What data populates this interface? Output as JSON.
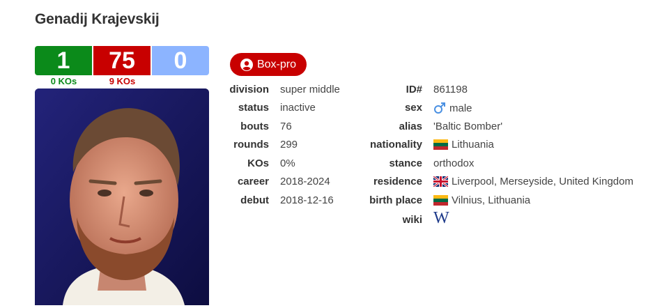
{
  "boxer": {
    "name": "Genadij Krajevskij",
    "record": {
      "wins": "1",
      "losses": "75",
      "draws": "0"
    },
    "win_kos": "0 KOs",
    "loss_kos": "9 KOs",
    "badge": "Box-pro",
    "photo_icon": "boxer-portrait"
  },
  "details_left": {
    "division": {
      "label": "division",
      "value": "super middle"
    },
    "status": {
      "label": "status",
      "value": "inactive"
    },
    "bouts": {
      "label": "bouts",
      "value": "76"
    },
    "rounds": {
      "label": "rounds",
      "value": "299"
    },
    "kos": {
      "label": "KOs",
      "value": "0%"
    },
    "career": {
      "label": "career",
      "value": "2018-2024"
    },
    "debut": {
      "label": "debut",
      "value": "2018-12-16"
    }
  },
  "details_right": {
    "id": {
      "label": "ID#",
      "value": "861198"
    },
    "sex": {
      "label": "sex",
      "value": "male",
      "icon": "male-symbol-icon"
    },
    "alias": {
      "label": "alias",
      "value": "'Baltic Bomber'"
    },
    "nationality": {
      "label": "nationality",
      "value": "Lithuania",
      "icon": "lithuania-flag-icon"
    },
    "stance": {
      "label": "stance",
      "value": "orthodox"
    },
    "residence": {
      "label": "residence",
      "value": "Liverpool, Merseyside, United Kingdom",
      "icon": "uk-flag-icon"
    },
    "birth_place": {
      "label": "birth place",
      "value": "Vilnius, Lithuania",
      "icon": "lithuania-flag-icon"
    },
    "wiki": {
      "label": "wiki",
      "icon": "wikipedia-icon",
      "glyph": "W"
    }
  },
  "colors": {
    "win": "#0b8a1a",
    "loss": "#c80000",
    "draw": "#8cb4ff",
    "badge": "#c80000",
    "male_icon": "#4a90e2"
  }
}
